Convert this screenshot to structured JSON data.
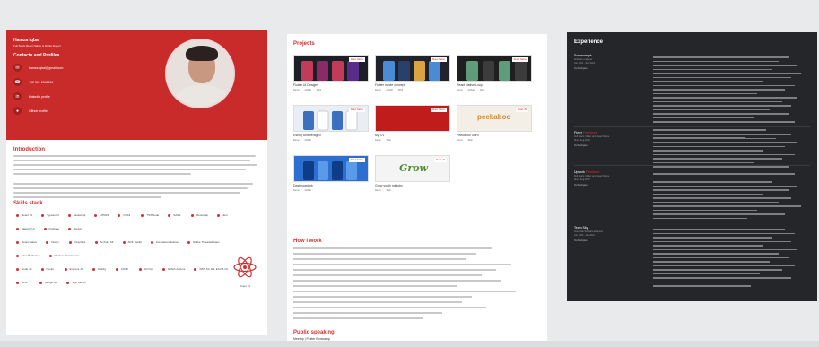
{
  "profile": {
    "name": "Hamza Iqbal",
    "role": "Full Stack React Native & Flutter Expert",
    "contacts_title": "Contacts and Profiles",
    "contacts": [
      {
        "icon": "email-icon",
        "label": "hamza.iqbal@gmail.com"
      },
      {
        "icon": "phone-icon",
        "label": "+92 301 2345124"
      },
      {
        "icon": "linkedin-icon",
        "label": "LinkedIn profile"
      },
      {
        "icon": "github-icon",
        "label": "Github profile"
      }
    ]
  },
  "intro": {
    "title": "Introduction"
  },
  "skills": {
    "title": "Skills stack",
    "rows": [
      [
        "React JS",
        "Typescript",
        "Javascript",
        "HTML5",
        "CSS3",
        "TSX/Node",
        "SASS",
        "Bootstrap",
        "Jest"
      ],
      [
        "Material UI",
        "Firebase",
        "Redux"
      ],
      [
        "React Native",
        "Flutter",
        "GraphQL",
        "Android SF",
        "ADF Toolkit",
        "Internationalization",
        "Stable Threaded Apps"
      ],
      [
        "Flow Perfect UI",
        "Flexbox Orientations"
      ],
      [
        "Node JS",
        "Nextjs",
        "Express JS",
        "Gatsby",
        "CI/CD",
        "Git Ops",
        "Github Actions",
        "AWS S3, EB, EC2 & CF"
      ],
      [
        "APIs",
        "Mongo DB",
        "SQL Server"
      ]
    ],
    "logo_caption": "React JS"
  },
  "projects": {
    "title": "Projects",
    "items": [
      {
        "title": "Flutter UI Designs",
        "badge": "React Native",
        "theme": "#1d1f27",
        "accent": "#c23b5a"
      },
      {
        "title": "Flutter movie concept",
        "badge": "React Native",
        "theme": "#20232b",
        "accent": "#4a8bd6"
      },
      {
        "title": "React Native Loop",
        "badge": "React Native",
        "theme": "#1f1f1f",
        "accent": "#5e9c7a"
      },
      {
        "title": "Esting Unleveraged",
        "badge": "React Native",
        "theme": "#e9eef4",
        "accent": "#3b6fbf"
      },
      {
        "title": "My CV",
        "badge": "React Native",
        "theme": "#c01c1c",
        "accent": "#8a0f0f"
      },
      {
        "title": "Peekaboo Guru",
        "badge": "React JS",
        "theme": "#f3efe6",
        "accent": "#d48a2a",
        "logo": "peekaboo"
      },
      {
        "title": "Dashboard.pk",
        "badge": "React Native",
        "theme": "#2c6fd0",
        "accent": "#0e3d86"
      },
      {
        "title": "Grow youth ministry",
        "badge": "React JS",
        "theme": "#f4f4f4",
        "accent": "#4f8d2d",
        "logo": "Grow"
      }
    ],
    "actions": [
      "Demo",
      "Github",
      "Web"
    ]
  },
  "how_i_work": {
    "title": "How I work"
  },
  "public_speaking": {
    "title": "Public speaking",
    "subtitle": "Meetup | Flutter Bootcamp"
  },
  "experience": {
    "title": "Experience",
    "jobs": [
      {
        "company": "Someone.pk",
        "role": "Software engineer",
        "dates": "Jan 2021 - Sep 2021",
        "tech_label": "Technologies"
      },
      {
        "company": "Fiverr",
        "highlight": "Freelance",
        "role": "Full Stack, Flutter and React Native",
        "dates": "Since Aug 2018",
        "tech_label": "Technologies"
      },
      {
        "company": "Upwork",
        "highlight": "Freelance",
        "role": "Full Stack, Flutter and React Native",
        "dates": "Since Aug 2019",
        "tech_label": "Technologies"
      },
      {
        "company": "Team Sky",
        "role": "Associate Software Engineer",
        "dates": "Jan 2020 - Jan 2021",
        "tech_label": "Technologies"
      }
    ]
  },
  "colors": {
    "accent": "#d23030",
    "hero": "#c92b2b",
    "dark": "#242629"
  }
}
